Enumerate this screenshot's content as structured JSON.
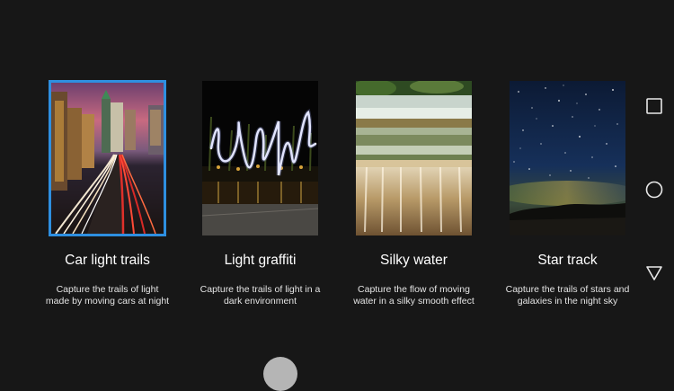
{
  "modes": [
    {
      "title": "Car light trails",
      "description": "Capture the trails of light made by moving cars at night",
      "selected": true,
      "thumbnail": "city-night-car-trails"
    },
    {
      "title": "Light graffiti",
      "description": "Capture the trails of light in a dark environment",
      "selected": false,
      "thumbnail": "light-painting-waterfront"
    },
    {
      "title": "Silky water",
      "description": "Capture the flow of moving water in a silky smooth effect",
      "selected": false,
      "thumbnail": "cascading-waterfall"
    },
    {
      "title": "Star track",
      "description": "Capture the trails of stars and galaxies in the night sky",
      "selected": false,
      "thumbnail": "starry-night-sky"
    }
  ],
  "nav": {
    "recents_icon": "square-icon",
    "home_icon": "circle-icon",
    "back_icon": "triangle-back-icon"
  },
  "colors": {
    "background": "#171717",
    "selection_border": "#2e8fe0",
    "shutter": "#b5b5b5"
  }
}
